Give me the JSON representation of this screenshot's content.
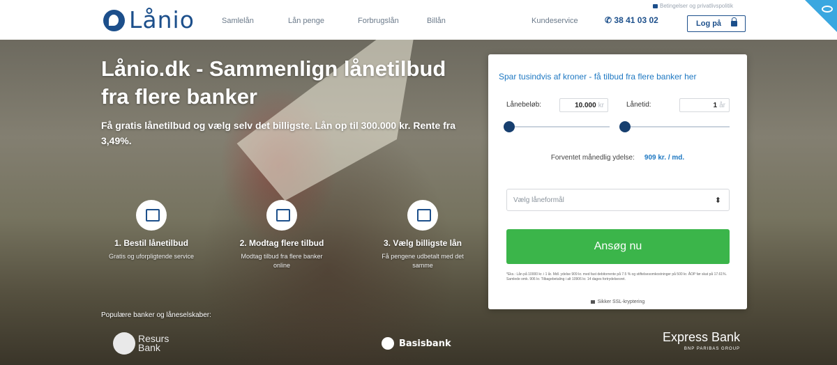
{
  "header": {
    "logo_text": "Lånio",
    "nav": [
      "Samlelån",
      "Lån penge",
      "Forbrugslån",
      "Billån",
      "Kundeservice"
    ],
    "privacy_link": "Betingelser og privatlivspolitik",
    "phone": "38 41 03 02",
    "login_label": "Log på"
  },
  "hero": {
    "title": "Lånio.dk - Sammenlign lånetilbud fra flere banker",
    "subtitle": "Få gratis lånetilbud og vælg selv det billigste. Lån op til 300.000 kr. Rente fra 3,49%.",
    "steps": [
      {
        "title": "1. Bestil lånetilbud",
        "text": "Gratis og uforpligtende service",
        "icon": "laptop-icon"
      },
      {
        "title": "2. Modtag flere tilbud",
        "text": "Modtag tilbud fra flere banker online",
        "icon": "documents-icon"
      },
      {
        "title": "3. Vælg billigste lån",
        "text": "Få pengene udbetalt med det samme",
        "icon": "money-bag-icon"
      }
    ],
    "banks_label": "Populære banker og låneselskaber:",
    "banks": {
      "resurs_line1": "Resurs",
      "resurs_line2": "Bank",
      "basis": "Basisbank",
      "express": "Express Bank",
      "express_sub": "BNP PARIBAS GROUP"
    }
  },
  "form": {
    "title": "Spar tusindvis af kroner - få tilbud fra flere banker her",
    "amount_label": "Lånebeløb:",
    "amount_value": "10.000",
    "amount_unit": "kr",
    "term_label": "Lånetid:",
    "term_value": "1",
    "term_unit": "år",
    "amount_slider_level": 0.0,
    "term_slider_level": 0.0,
    "monthly_label": "Forventet månedlig ydelse:",
    "monthly_value": "909 kr. / md.",
    "purpose_placeholder": "Vælg låneformål",
    "apply_label": "Ansøg nu",
    "fineprint": "*Eks.: Lån på 10000 kr. i 1 år. Mdl. ydelse 909 kr. med fast debitorrente på 7.5 % og stiftelsesomkostninger på 500 kr. ÅOP før skat på 17.61%. Samlede omk. 906 kr. Tilbagebetaling i alt 10906 kr. 14 dages fortrydelsesret.",
    "ssl_label": "Sikker SSL-kryptering"
  },
  "colors": {
    "brand": "#1c4f8b",
    "accent": "#1e78c2",
    "cta": "#3bb54a"
  }
}
